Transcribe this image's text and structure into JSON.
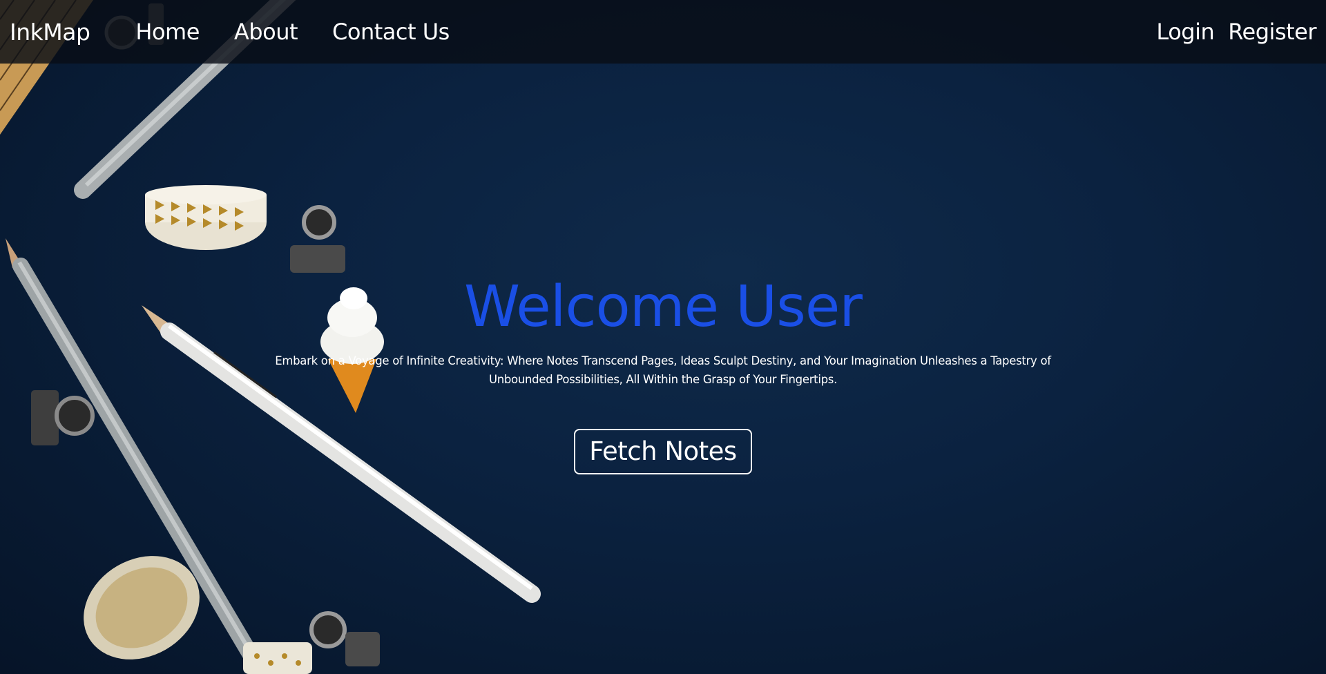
{
  "navbar": {
    "brand": "InkMap",
    "links": [
      "Home",
      "About",
      "Contact Us"
    ],
    "auth": {
      "login": "Login",
      "register": "Register"
    }
  },
  "hero": {
    "title": "Welcome User",
    "subtitle": "Embark on a Voyage of Infinite Creativity: Where Notes Transcend Pages, Ideas Sculpt Destiny, and Your Imagination Unleashes a Tapestry of Unbounded Possibilities, All Within the Grasp of Your Fingertips.",
    "button_label": "Fetch Notes"
  },
  "background": {
    "description_icons": [
      "ruler-icon",
      "pencil-icon",
      "washi-tape-icon",
      "binder-clip-icon",
      "ice-cream-eraser-icon"
    ]
  },
  "colors": {
    "background": "#0b2240",
    "navbar": "#080e16",
    "title_accent": "#1a4fe6",
    "text": "#ffffff"
  }
}
